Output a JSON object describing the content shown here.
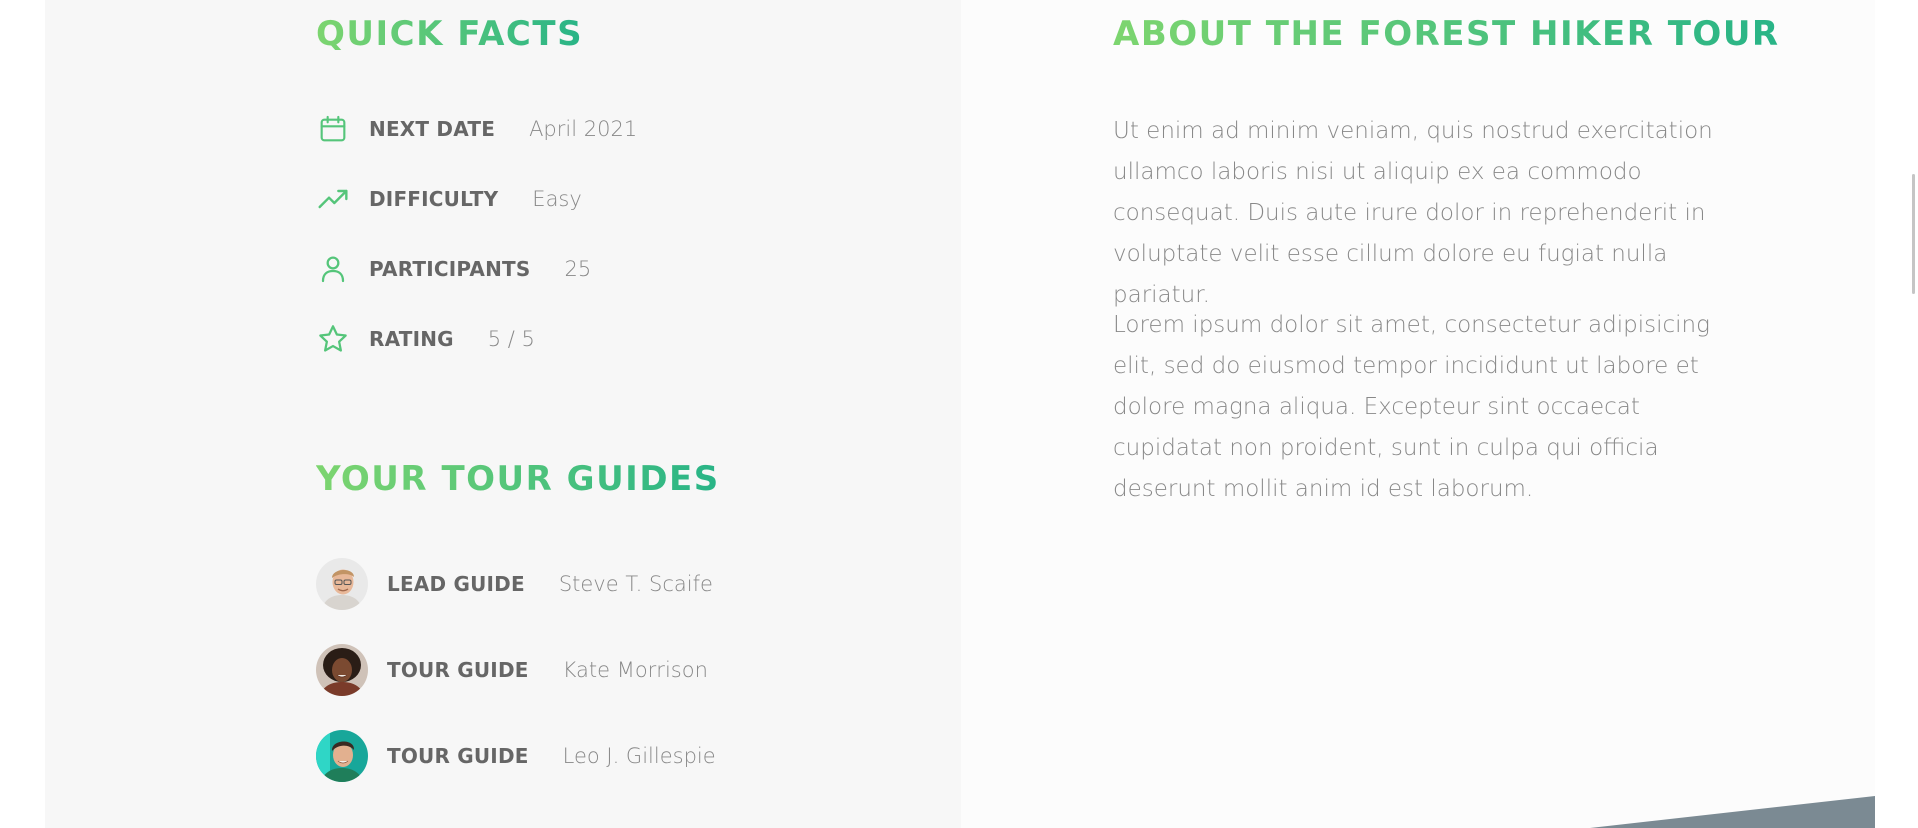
{
  "quick_facts": {
    "title": "Quick facts",
    "items": [
      {
        "icon": "calendar-icon",
        "label": "Next date",
        "value": "April 2021"
      },
      {
        "icon": "trending-up-icon",
        "label": "Difficulty",
        "value": "Easy"
      },
      {
        "icon": "user-icon",
        "label": "Participants",
        "value": "25"
      },
      {
        "icon": "star-icon",
        "label": "Rating",
        "value": "5 / 5"
      }
    ]
  },
  "tour_guides": {
    "title": "Your tour guides",
    "guides": [
      {
        "role": "Lead guide",
        "name": "Steve T. Scaife",
        "avatar": "avatar-steve"
      },
      {
        "role": "Tour guide",
        "name": "Kate Morrison",
        "avatar": "avatar-kate"
      },
      {
        "role": "Tour guide",
        "name": "Leo J. Gillespie",
        "avatar": "avatar-leo"
      }
    ]
  },
  "about": {
    "title": "About the Forest Hiker tour",
    "paragraphs": [
      "Ut enim ad minim veniam, quis nostrud exercitation ullamco laboris nisi ut aliquip ex ea commodo consequat. Duis aute irure dolor in reprehenderit in voluptate velit esse cillum dolore eu fugiat nulla pariatur.",
      "Lorem ipsum dolor sit amet, consectetur adipisicing elit, sed do eiusmod tempor incididunt ut labore et dolore magna aliqua. Excepteur sint occaecat cupidatat non proident, sunt in culpa qui officia deserunt mollit anim id est laborum."
    ]
  },
  "colors": {
    "accent_light": "#7dd56f",
    "accent_dark": "#28b487",
    "text_label": "#666666",
    "text_value": "#888888",
    "panel_left": "#f7f7f7",
    "panel_right": "#fcfcfc"
  }
}
